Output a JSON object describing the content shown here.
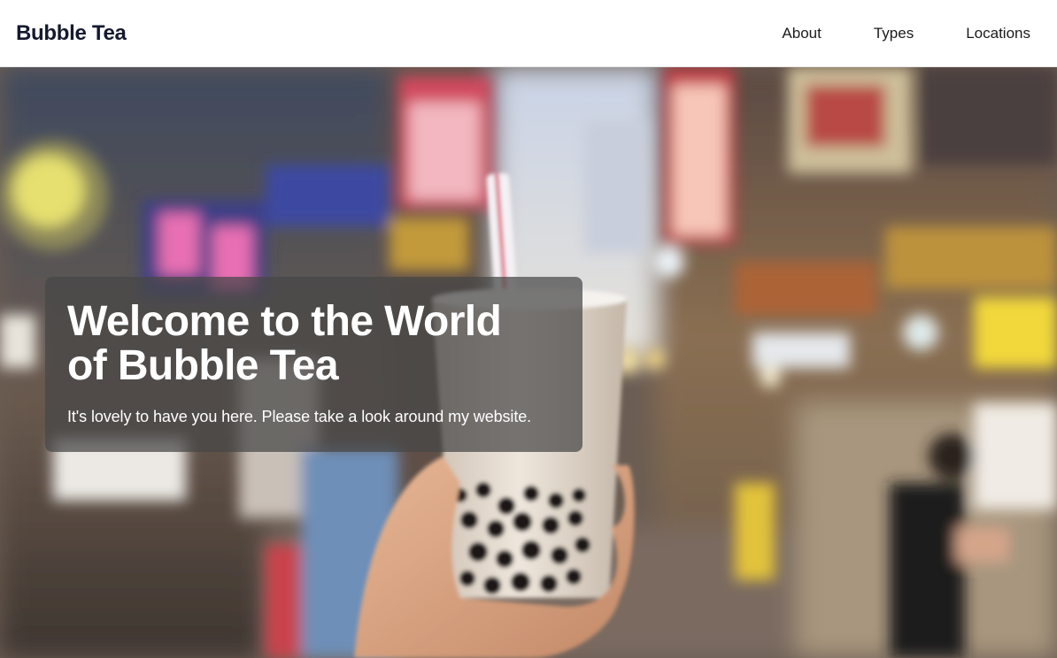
{
  "header": {
    "brand": "Bubble Tea",
    "nav": [
      {
        "label": "About"
      },
      {
        "label": "Types"
      },
      {
        "label": "Locations"
      }
    ]
  },
  "hero": {
    "title": "Welcome to the World of Bubble Tea",
    "subtitle": "It's lovely to have you here. Please take a look around my website.",
    "image_alt": "hand-holding-bubble-tea-in-night-market-photo"
  },
  "colors": {
    "brand_text": "#141a2e",
    "card_overlay": "rgba(70,70,70,0.72)"
  }
}
